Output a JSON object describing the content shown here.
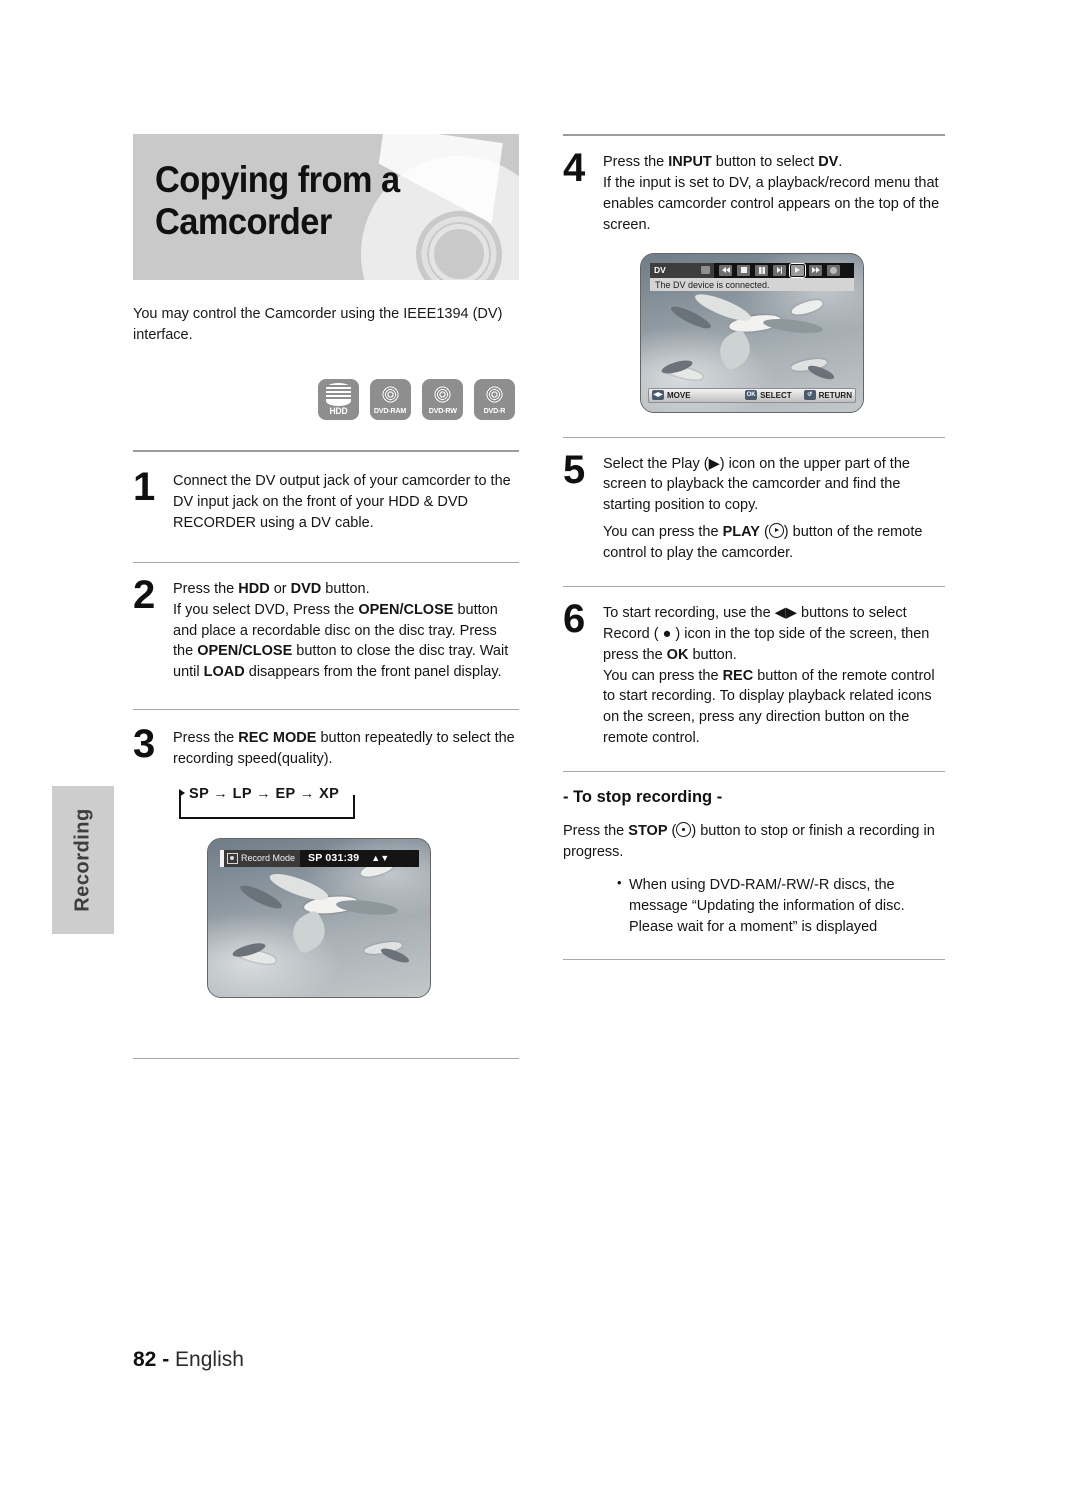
{
  "page": {
    "footer_number": "82",
    "footer_sep": "-",
    "footer_lang": "English",
    "side_tab_label": "Recording"
  },
  "banner": {
    "title": "Copying from a Camcorder"
  },
  "intro": {
    "text": "You may control the Camcorder using the IEEE1394 (DV) interface."
  },
  "disc_badges": [
    {
      "label": "HDD",
      "icon": "hdd-stack-icon"
    },
    {
      "label": "DVD-RAM",
      "icon": "disc-icon"
    },
    {
      "label": "DVD-RW",
      "icon": "disc-icon"
    },
    {
      "label": "DVD-R",
      "icon": "disc-icon"
    }
  ],
  "steps": {
    "s1": {
      "num": "1",
      "line1": "Connect the DV output jack of your camcorder to the DV input jack on the front of your HDD & DVD RECORDER using a DV cable."
    },
    "s2": {
      "num": "2",
      "l1_a": "Press the ",
      "l1_b": "HDD",
      "l1_c": " or ",
      "l1_d": "DVD",
      "l1_e": " button.",
      "l2_a": "If you select DVD, Press the ",
      "l2_b": "OPEN/CLOSE",
      "l2_c": " button and place a recordable disc on the disc tray. Press the ",
      "l2_d": "OPEN/CLOSE",
      "l2_e": " button to close the disc tray. Wait until ",
      "l2_f": "LOAD",
      "l2_g": " disappears from the front panel display."
    },
    "s3": {
      "num": "3",
      "a": "Press the ",
      "b": "REC MODE",
      "c": " button repeatedly to select the recording speed(quality).",
      "loop": "SP → LP → EP → XP"
    },
    "s4": {
      "num": "4",
      "l1_a": "Press the ",
      "l1_b": "INPUT",
      "l1_c": " button to select ",
      "l1_d": "DV",
      "l1_e": ".",
      "l2": "If the input is set to DV, a playback/record menu that enables camcorder control appears on the top of the screen."
    },
    "s5": {
      "num": "5",
      "l1": "Select the Play (▶) icon on the upper part of the screen to playback the camcorder and find the starting position to copy.",
      "l2_a": "You can press the ",
      "l2_b": "PLAY",
      "l2_c": " (",
      "l2_d": ") button of the remote control to play the camcorder."
    },
    "s6": {
      "num": "6",
      "l1_a": "To start recording, use the ◀▶ buttons to select Record ( ● ) icon in the top side of the screen, then press the ",
      "l1_b": "OK",
      "l1_c": " button.",
      "l2_a": "You can press the ",
      "l2_b": "REC",
      "l2_c": " button of the remote control to start recording. To display playback related icons on the screen, press any direction button on the remote control."
    }
  },
  "stop_section": {
    "heading": "- To stop recording -",
    "para_a": "Press the ",
    "para_b": "STOP",
    "para_c": " (",
    "para_d": ") button to stop or finish a recording in progress.",
    "bullets": [
      "When using DVD-RAM/-RW/-R discs, the message “Updating the information of disc. Please wait for a moment” is displayed"
    ]
  },
  "screenshot_recmode": {
    "osd_label": "Record Mode",
    "osd_value": "SP 031:39",
    "caption_alt": "seagulls flying"
  },
  "screenshot_dv": {
    "device_name": "DV",
    "message": "The DV device is connected.",
    "controls": [
      {
        "name": "rewind-icon",
        "selected": false
      },
      {
        "name": "stop-icon",
        "selected": false
      },
      {
        "name": "pause-icon",
        "selected": false
      },
      {
        "name": "step-forward-icon",
        "selected": false
      },
      {
        "name": "play-icon",
        "selected": true
      },
      {
        "name": "fast-forward-icon",
        "selected": false
      },
      {
        "name": "record-icon",
        "selected": false
      }
    ],
    "bottom_bar": [
      {
        "key": "◀▶",
        "label": "MOVE"
      },
      {
        "key": "OK",
        "label": "SELECT"
      },
      {
        "key": "↺",
        "label": "RETURN"
      }
    ]
  },
  "colors": {
    "banner_bg": "#c9c9c9",
    "rule": "#9b9b9b",
    "side_tab_bg": "#cdcdcd",
    "badge_bg": "#8e8e8e",
    "text": "#151515"
  }
}
